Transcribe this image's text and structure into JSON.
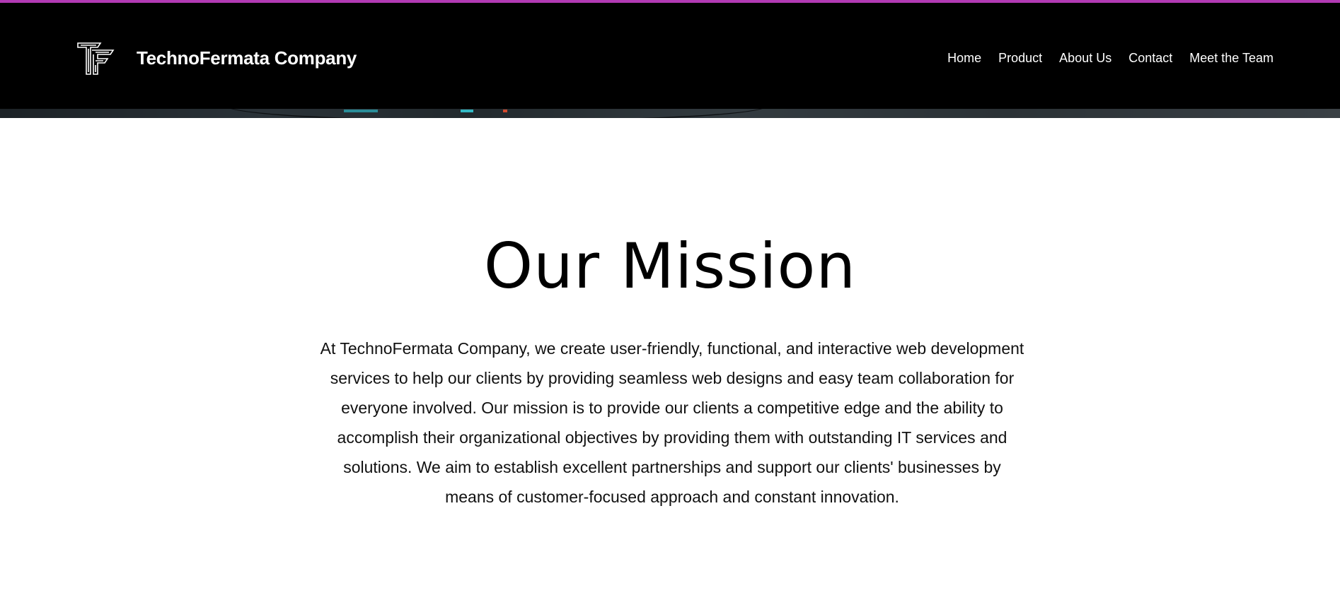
{
  "header": {
    "brand": "TechnoFermata Company",
    "logo_icon": "tf-monogram-logo-icon"
  },
  "nav": {
    "items": [
      {
        "label": "Home"
      },
      {
        "label": "Product"
      },
      {
        "label": "About Us"
      },
      {
        "label": "Contact"
      },
      {
        "label": "Meet the Team"
      }
    ]
  },
  "mission": {
    "title": "Our Mission",
    "body": "At TechnoFermata Company, we create user-friendly, functional, and interactive web development services to help our clients by providing seamless web designs and easy team collaboration for everyone involved. Our mission is to provide our clients a competitive edge and the ability to accomplish their organizational objectives by providing them with outstanding IT services and solutions. We aim to establish excellent partnerships and support our clients' businesses by means of customer-focused approach and constant innovation."
  },
  "colors": {
    "accent": "#b23ab4",
    "header_bg": "#000000",
    "text": "#000000"
  }
}
